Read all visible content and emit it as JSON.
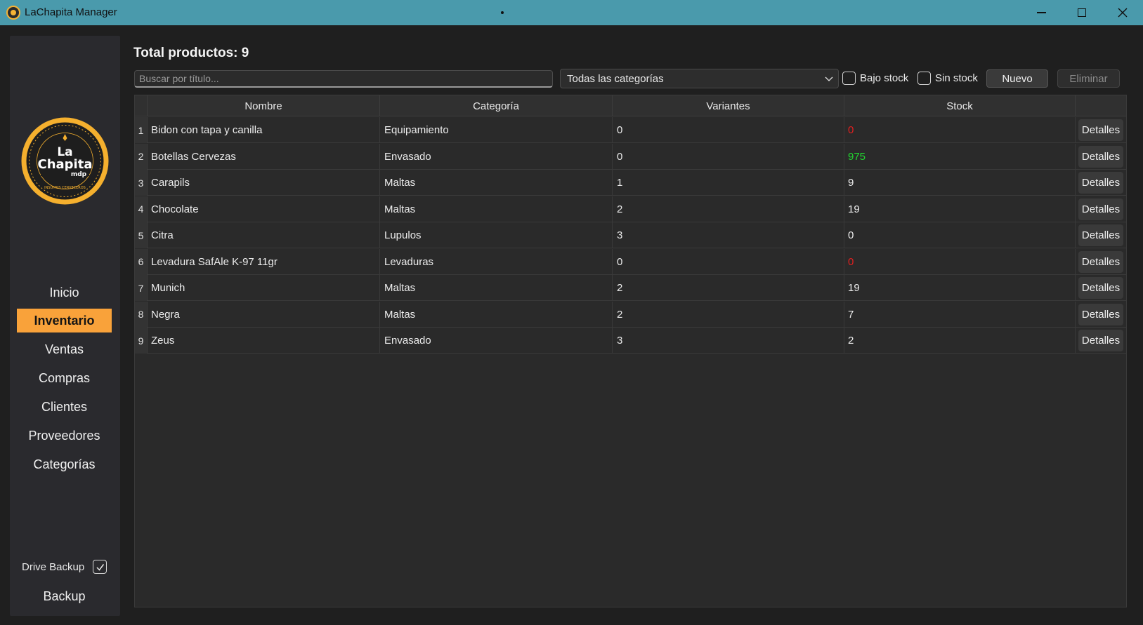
{
  "window": {
    "title": "LaChapita Manager",
    "title_dot": "•"
  },
  "sidebar": {
    "logo": {
      "line1": "La",
      "line2": "Chapita",
      "line3": "mdp",
      "ring": "INSUMOS CERVECEROS"
    },
    "items": [
      {
        "label": "Inicio",
        "active": false
      },
      {
        "label": "Inventario",
        "active": true
      },
      {
        "label": "Ventas",
        "active": false
      },
      {
        "label": "Compras",
        "active": false
      },
      {
        "label": "Clientes",
        "active": false
      },
      {
        "label": "Proveedores",
        "active": false
      },
      {
        "label": "Categorías",
        "active": false
      }
    ],
    "drive_backup_label": "Drive Backup",
    "drive_backup_checked": true,
    "backup_label": "Backup"
  },
  "main": {
    "title": "Total productos: 9",
    "search_placeholder": "Buscar por título...",
    "category_select": "Todas las categorías",
    "filter_low_stock": "Bajo stock",
    "filter_no_stock": "Sin stock",
    "new_button": "Nuevo",
    "delete_button": "Eliminar"
  },
  "table": {
    "columns": [
      "Nombre",
      "Categoría",
      "Variantes",
      "Stock"
    ],
    "details_label": "Detalles",
    "rows": [
      {
        "num": "1",
        "name": "Bidon con tapa y canilla",
        "category": "Equipamiento",
        "variants": "0",
        "stock": "0",
        "stock_status": "red"
      },
      {
        "num": "2",
        "name": "Botellas Cervezas",
        "category": "Envasado",
        "variants": "0",
        "stock": "975",
        "stock_status": "green"
      },
      {
        "num": "3",
        "name": "Carapils",
        "category": "Maltas",
        "variants": "1",
        "stock": "9",
        "stock_status": "normal"
      },
      {
        "num": "4",
        "name": "Chocolate",
        "category": "Maltas",
        "variants": "2",
        "stock": "19",
        "stock_status": "normal"
      },
      {
        "num": "5",
        "name": "Citra",
        "category": "Lupulos",
        "variants": "3",
        "stock": "0",
        "stock_status": "normal"
      },
      {
        "num": "6",
        "name": "Levadura SafAle K-97 11gr",
        "category": "Levaduras",
        "variants": "0",
        "stock": "0",
        "stock_status": "red"
      },
      {
        "num": "7",
        "name": "Munich",
        "category": "Maltas",
        "variants": "2",
        "stock": "19",
        "stock_status": "normal"
      },
      {
        "num": "8",
        "name": "Negra",
        "category": "Maltas",
        "variants": "2",
        "stock": "7",
        "stock_status": "normal"
      },
      {
        "num": "9",
        "name": "Zeus",
        "category": "Envasado",
        "variants": "3",
        "stock": "2",
        "stock_status": "normal"
      }
    ]
  },
  "colors": {
    "titlebar": "#4a9aac",
    "accent": "#f9a23a",
    "stock_red": "#e02020",
    "stock_green": "#22d430"
  }
}
